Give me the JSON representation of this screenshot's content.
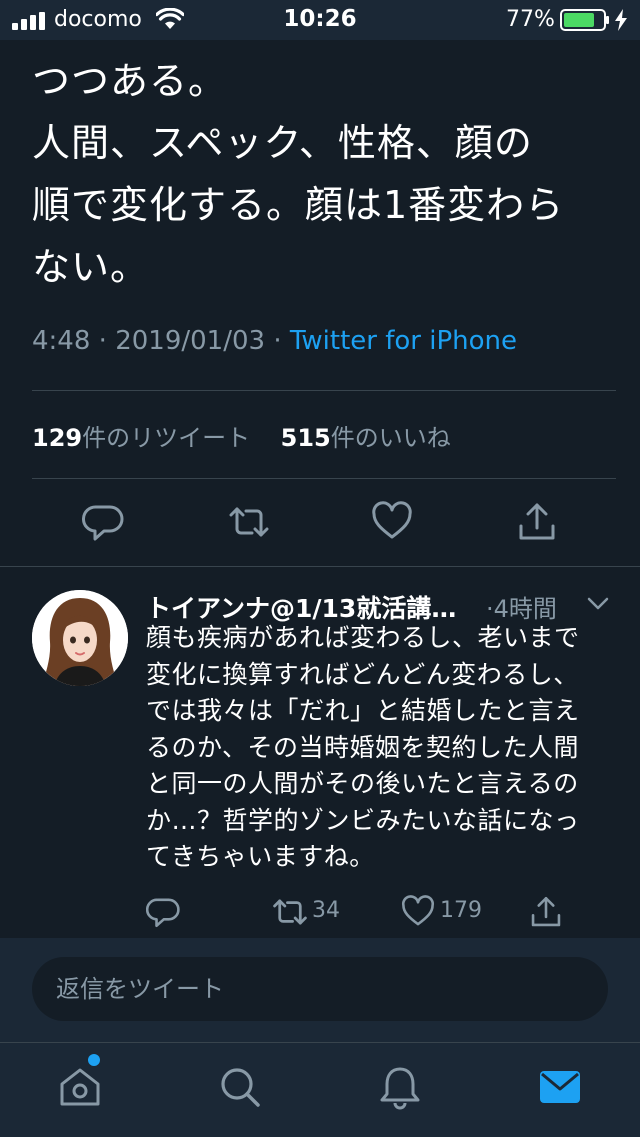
{
  "status_bar": {
    "carrier": "docomo",
    "time": "10:26",
    "battery_percent": "77%"
  },
  "tweet": {
    "text_lines": [
      "つつある。",
      "人間、スペック、性格、顔の",
      "順で変化する。顔は1番変わら",
      "ない。"
    ],
    "time": "4:48",
    "date": "2019/01/03",
    "separator": "·",
    "source": "Twitter for iPhone",
    "retweets_count": "129",
    "retweets_label": "件のリツイート",
    "likes_count": "515",
    "likes_label": "件のいいね"
  },
  "reply": {
    "name": "トイアンナ@1/13就活講…",
    "time": "·4時間",
    "text_lines": [
      "顔も疾病があれば変わるし、老いまで",
      "変化に換算すればどんどん変わるし、",
      "では我々は「だれ」と結婚したと言え",
      "るのか、その当時婚姻を契約した人間",
      "と同一の人間がその後いたと言えるの",
      "か…？哲学的ゾンビみたいな話になっ",
      "てきちゃいますね。"
    ],
    "retweet_count": "34",
    "like_count": "179"
  },
  "reply_input": {
    "placeholder": "返信をツイート"
  },
  "tabs": [
    "home-icon",
    "search-icon",
    "notifications-icon",
    "messages-icon"
  ],
  "colors": {
    "background": "#141d26",
    "bar": "#1b2836",
    "accent": "#1da1f2",
    "secondary_text": "#8899a6",
    "battery": "#4cd964"
  }
}
